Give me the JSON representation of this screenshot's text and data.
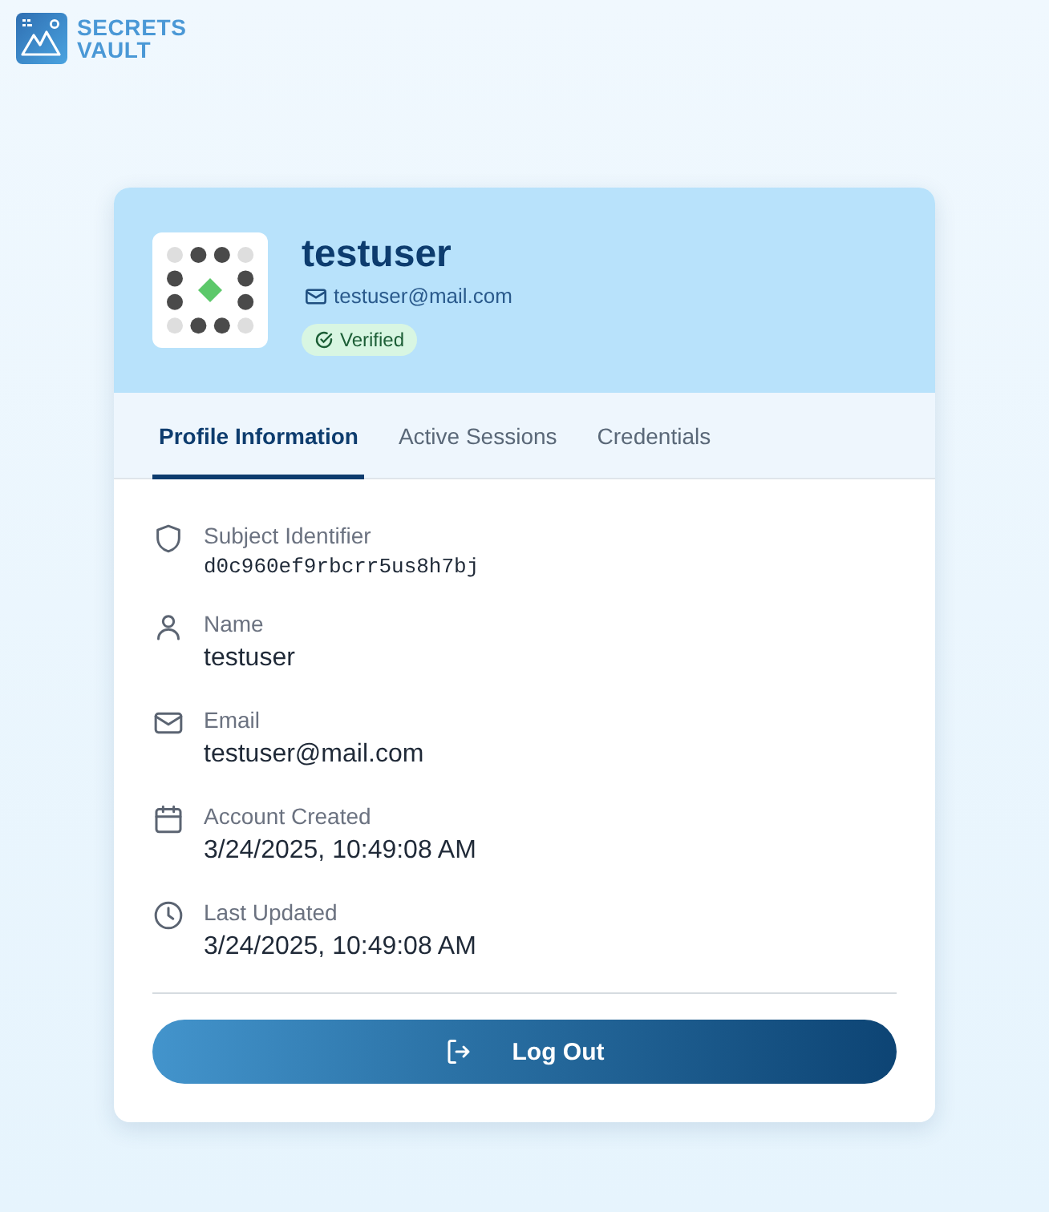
{
  "logo": {
    "line_1": "SECRETS",
    "line_2": "VAULT"
  },
  "profile": {
    "username": "testuser",
    "email": "testuser@mail.com",
    "badge": {
      "label": "Verified",
      "verified": true
    }
  },
  "tabs": [
    {
      "label": "Profile Information",
      "selected": true
    },
    {
      "label": "Active Sessions",
      "selected": false
    },
    {
      "label": "Credentials",
      "selected": false
    }
  ],
  "fields": [
    {
      "kind": "identifier",
      "label": "Subject Identifier",
      "value": "d0c960ef9rbcrr5us8h7bj"
    },
    {
      "kind": "name",
      "label": "Name",
      "value": "testuser"
    },
    {
      "kind": "email",
      "label": "Email",
      "value": "testuser@mail.com"
    },
    {
      "kind": "created",
      "label": "Account Created",
      "value": "3/24/2025, 10:49:08 AM"
    },
    {
      "kind": "updated",
      "label": "Last Updated",
      "value": "3/24/2025, 10:49:08 AM"
    }
  ],
  "logout_button": {
    "label": "Log Out"
  }
}
